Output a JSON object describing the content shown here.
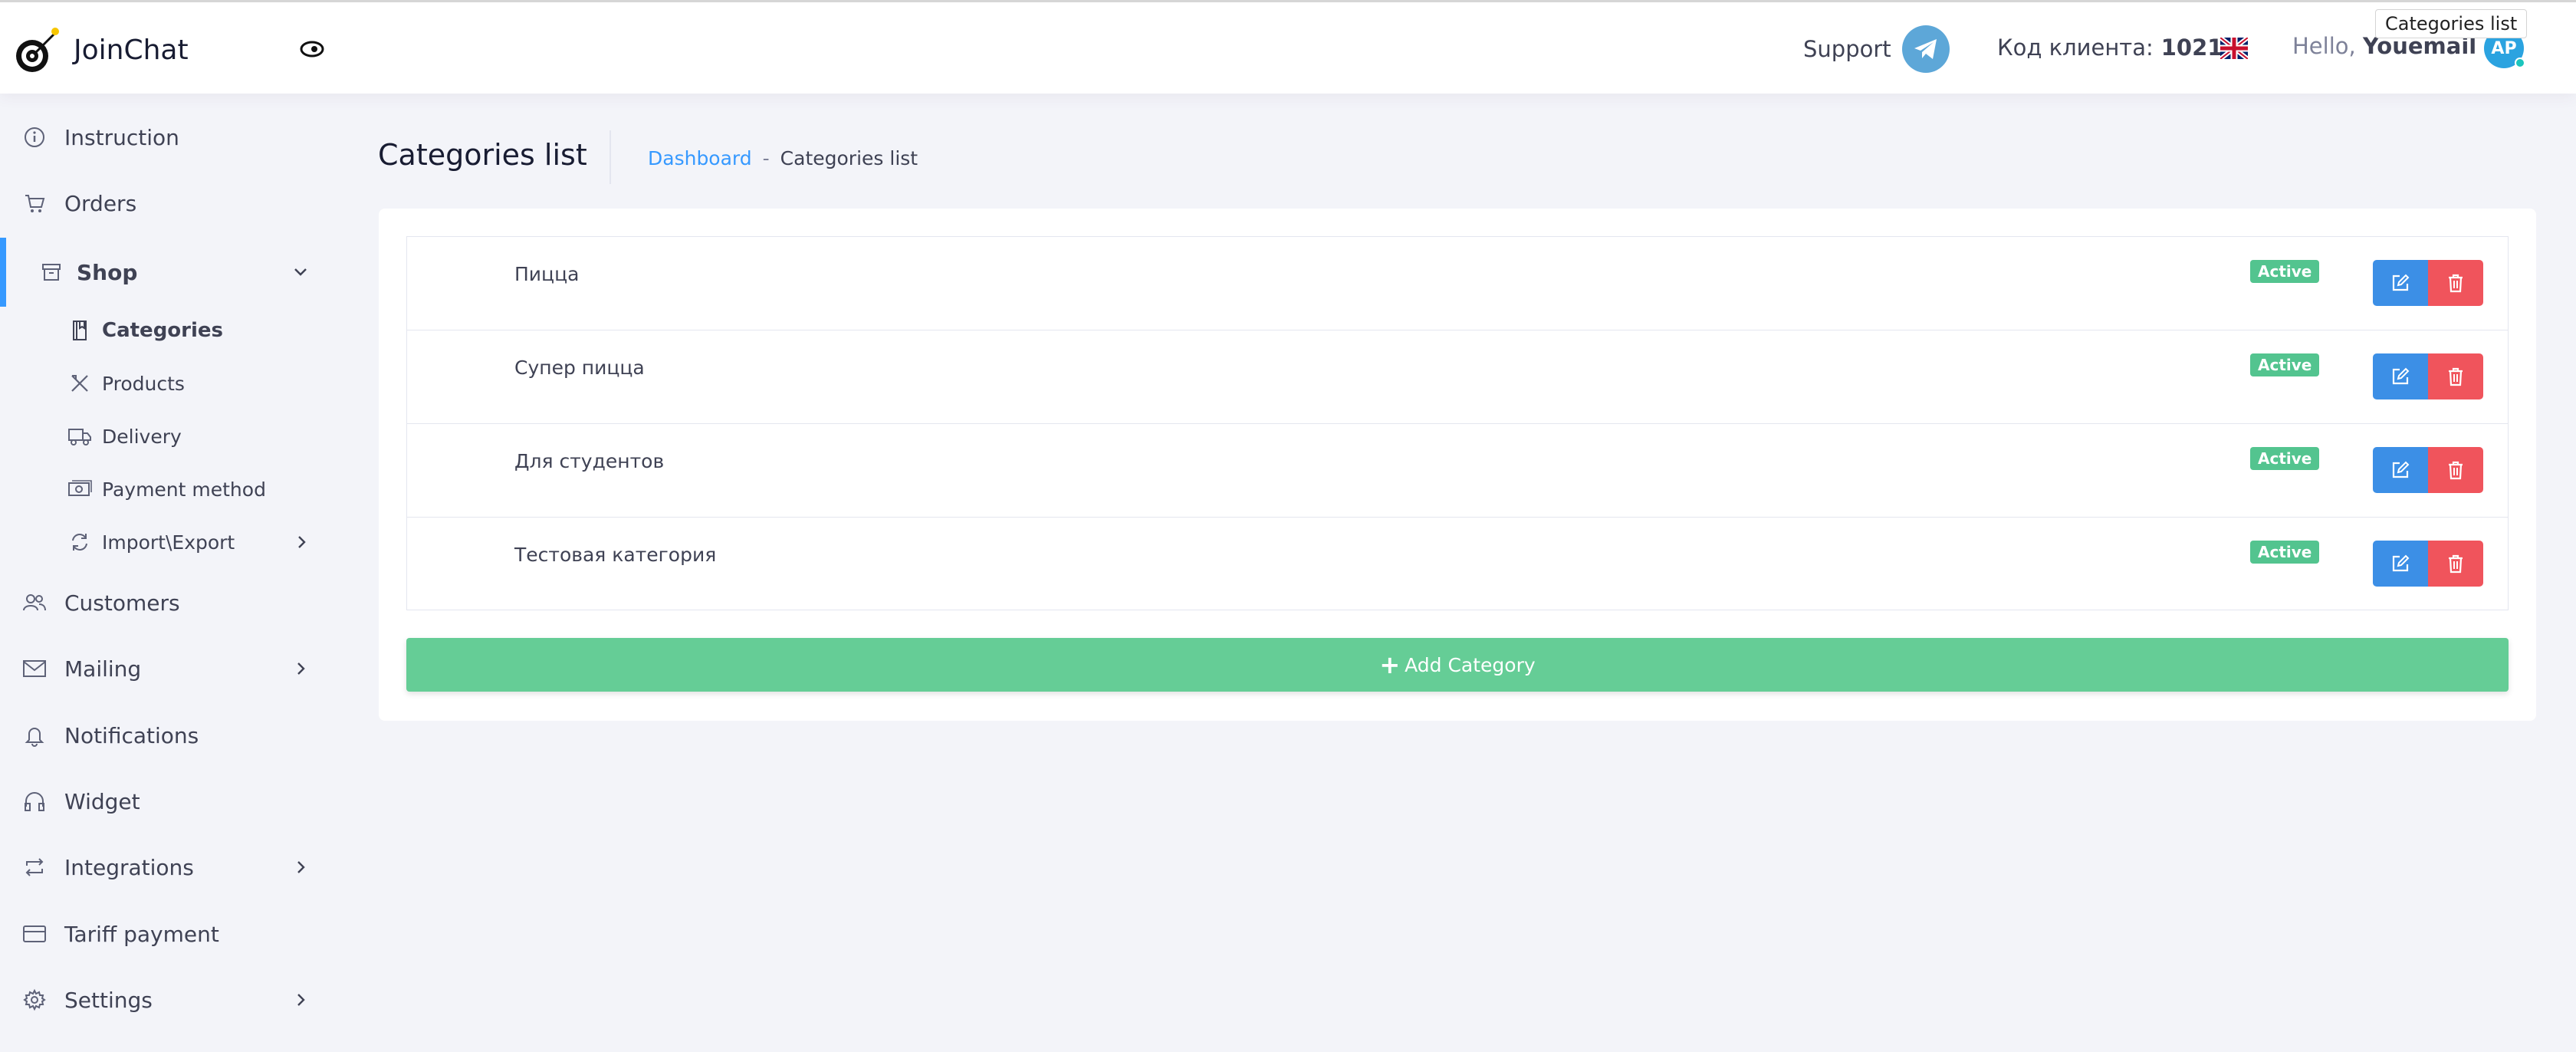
{
  "header": {
    "brand": "JoinChat",
    "support_label": "Support",
    "client_code_label": "Код клиента:",
    "client_code_value": "1021",
    "hello_label": "Hello,",
    "user_name": "Youemail",
    "avatar_initials": "AP",
    "tooltip": "Categories list"
  },
  "sidebar": {
    "items": [
      {
        "label": "Instruction",
        "icon": "info-icon"
      },
      {
        "label": "Orders",
        "icon": "cart-icon"
      },
      {
        "label": "Shop",
        "icon": "box-icon"
      },
      {
        "label": "Customers",
        "icon": "users-icon"
      },
      {
        "label": "Mailing",
        "icon": "mail-icon"
      },
      {
        "label": "Notifications",
        "icon": "bell-icon"
      },
      {
        "label": "Widget",
        "icon": "headphones-icon"
      },
      {
        "label": "Integrations",
        "icon": "repeat-icon"
      },
      {
        "label": "Tariff payment",
        "icon": "credit-card-icon"
      },
      {
        "label": "Settings",
        "icon": "gear-icon"
      }
    ],
    "shop_sub": [
      {
        "label": "Categories",
        "icon": "book-icon"
      },
      {
        "label": "Products",
        "icon": "utensils-icon"
      },
      {
        "label": "Delivery",
        "icon": "truck-icon"
      },
      {
        "label": "Payment method",
        "icon": "money-icon"
      },
      {
        "label": "Import\\Export",
        "icon": "sync-icon"
      }
    ]
  },
  "page": {
    "title": "Categories list",
    "breadcrumb": {
      "link": "Dashboard",
      "separator": "-",
      "current": "Categories list"
    }
  },
  "categories": [
    {
      "name": "Пицца",
      "status": "Active"
    },
    {
      "name": "Супер пицца",
      "status": "Active"
    },
    {
      "name": "Для студентов",
      "status": "Active"
    },
    {
      "name": "Тестовая категория",
      "status": "Active"
    }
  ],
  "add_button_label": "Add Category",
  "colors": {
    "accent": "#3699ff",
    "success": "#65cd96",
    "badge": "#53c48f",
    "danger": "#f0545c",
    "edit": "#3c8fe6",
    "telegram": "#5da7d8"
  }
}
